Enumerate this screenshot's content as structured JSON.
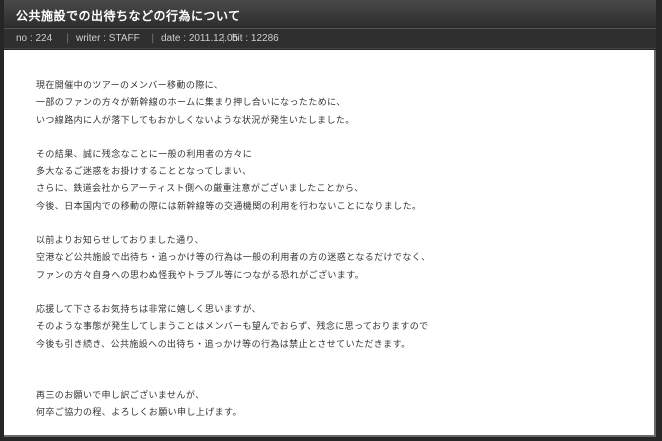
{
  "title": "公共施設での出待ちなどの行為について",
  "meta": {
    "no_label": "no",
    "no_value": "224",
    "writer_label": "writer",
    "writer_value": "STAFF",
    "date_label": "date",
    "date_value": "2011.12.05",
    "hit_label": "hit",
    "hit_value": "12286"
  },
  "paragraphs": [
    {
      "lines": [
        "現在開催中のツアーのメンバー移動の際に、",
        "一部のファンの方々が新幹線のホームに集まり押し合いになったために、",
        "いつ線路内に人が落下してもおかしくないような状況が発生いたしました。"
      ]
    },
    {
      "lines": [
        "その結果、誠に残念なことに一般の利用者の方々に",
        "多大なるご迷惑をお掛けすることとなってしまい、",
        "さらに、鉄道会社からアーティスト側への厳重注意がございましたことから、",
        "今後、日本国内での移動の際には新幹線等の交通機関の利用を行わないことになりました。"
      ]
    },
    {
      "lines": [
        "以前よりお知らせしておりました通り、",
        "空港など公共施設で出待ち・追っかけ等の行為は一般の利用者の方の迷惑となるだけでなく、",
        "ファンの方々自身への思わぬ怪我やトラブル等につながる恐れがございます。"
      ]
    },
    {
      "lines": [
        "応援して下さるお気持ちは非常に嬉しく思いますが、",
        "そのような事態が発生してしまうことはメンバーも望んでおらず、残念に思っておりますので",
        "今後も引き続き、公共施設への出待ち・追っかけ等の行為は禁止とさせていただきます。"
      ]
    },
    {
      "lines": [
        "再三のお願いで申し訳ございませんが、",
        "何卒ご協力の程、よろしくお願い申し上げます。"
      ]
    }
  ]
}
